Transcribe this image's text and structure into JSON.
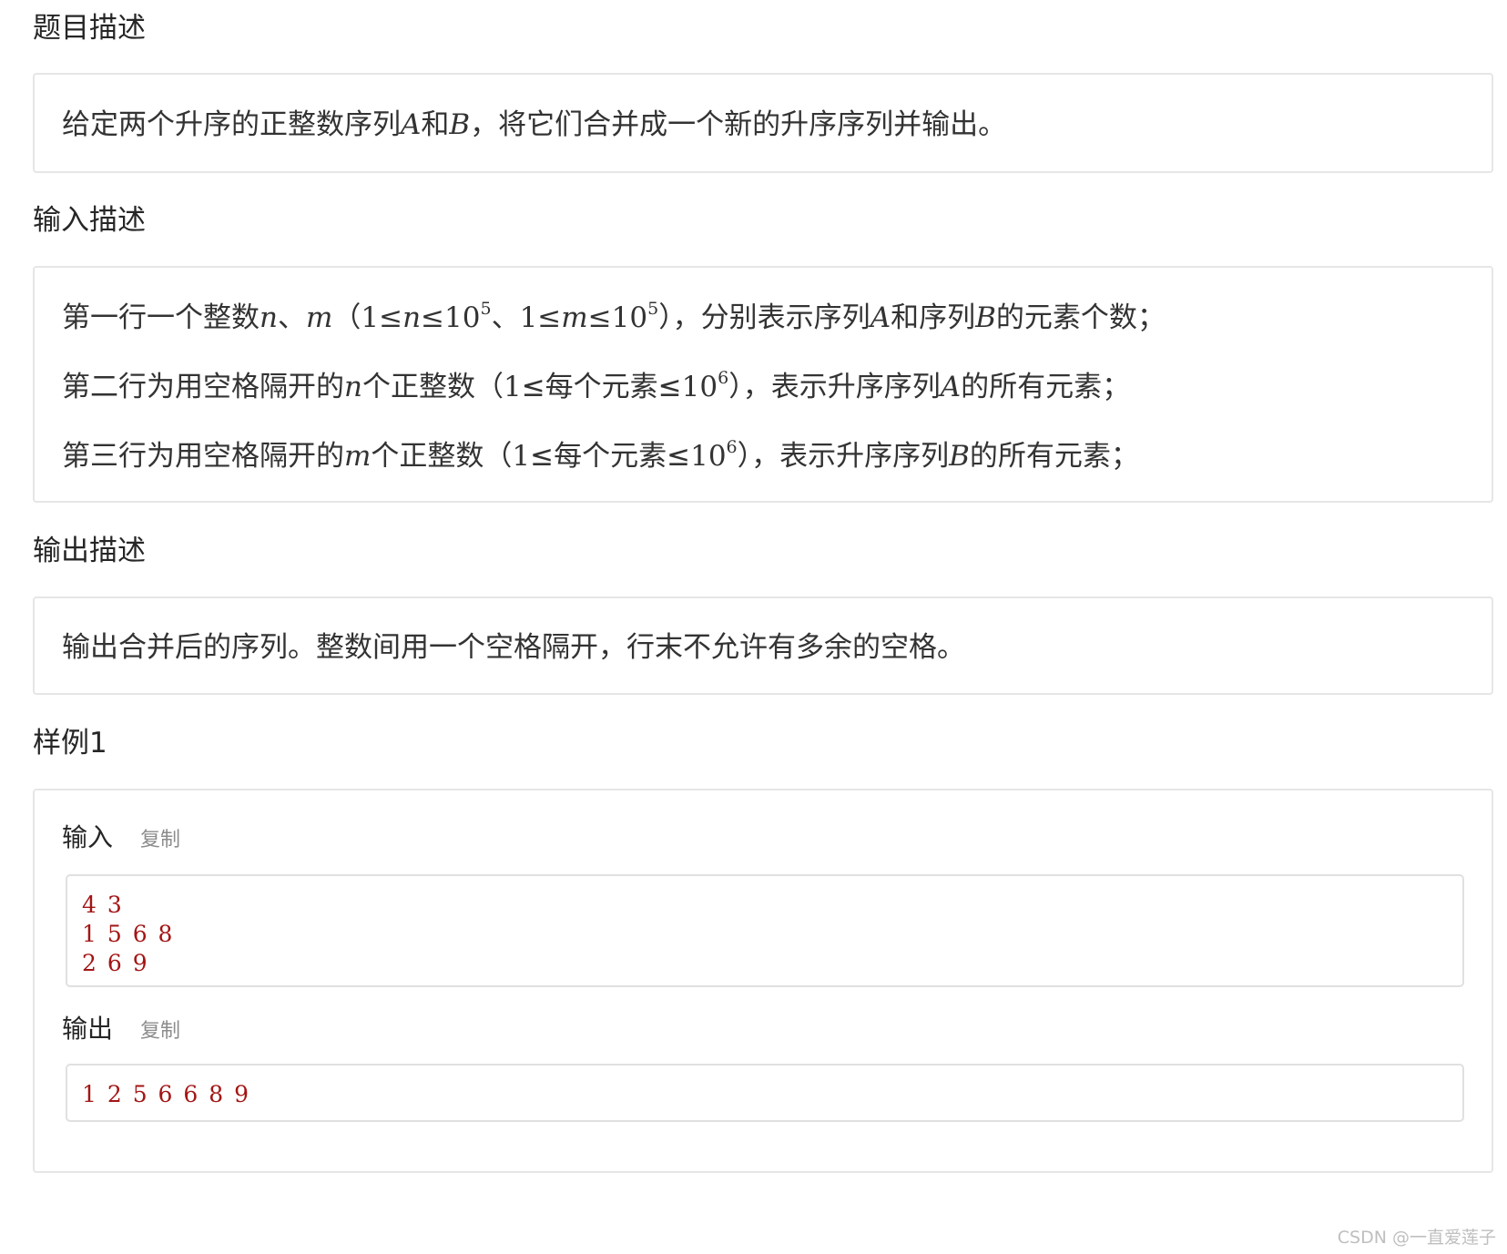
{
  "problem": {
    "title": "题目描述",
    "desc_a": "给定两个升序的正整数序列",
    "var_a": "A",
    "desc_b": "和",
    "var_b": "B",
    "desc_c": "，将它们合并成一个新的升序序列并输出。"
  },
  "input": {
    "title": "输入描述",
    "line1": {
      "t1": "第一行一个整数",
      "n": "n",
      "t2": "、",
      "m": "m",
      "t3": "（",
      "r1": "1≤",
      "rn": "n",
      "r2": "≤10",
      "e1": "5",
      "t4": "、",
      "r3": "1≤",
      "rm": "m",
      "r4": "≤10",
      "e2": "5",
      "t5": "），分别表示序列",
      "A": "A",
      "t6": "和序列",
      "B": "B",
      "t7": "的元素个数；"
    },
    "line2": {
      "t1": "第二行为用空格隔开的",
      "n": "n",
      "t2": "个正整数（",
      "r1": "1",
      "t3": "≤每个元素≤",
      "r2": "10",
      "e": "6",
      "t4": "），表示升序序列",
      "A": "A",
      "t5": "的所有元素；"
    },
    "line3": {
      "t1": "第三行为用空格隔开的",
      "m": "m",
      "t2": "个正整数（",
      "r1": "1",
      "t3": "≤每个元素≤",
      "r2": "10",
      "e": "6",
      "t4": "），表示升序序列",
      "B": "B",
      "t5": "的所有元素；"
    }
  },
  "output": {
    "title": "输出描述",
    "text": "输出合并后的序列。整数间用一个空格隔开，行末不允许有多余的空格。"
  },
  "sample": {
    "title": "样例1",
    "input_label": "输入",
    "output_label": "输出",
    "copy_label": "复制",
    "input_lines": [
      "4 3",
      "1 5 6 8",
      "2 6 9"
    ],
    "output_lines": [
      "1 2 5 6 6 8 9"
    ]
  },
  "watermark": "CSDN @一直爱莲子"
}
